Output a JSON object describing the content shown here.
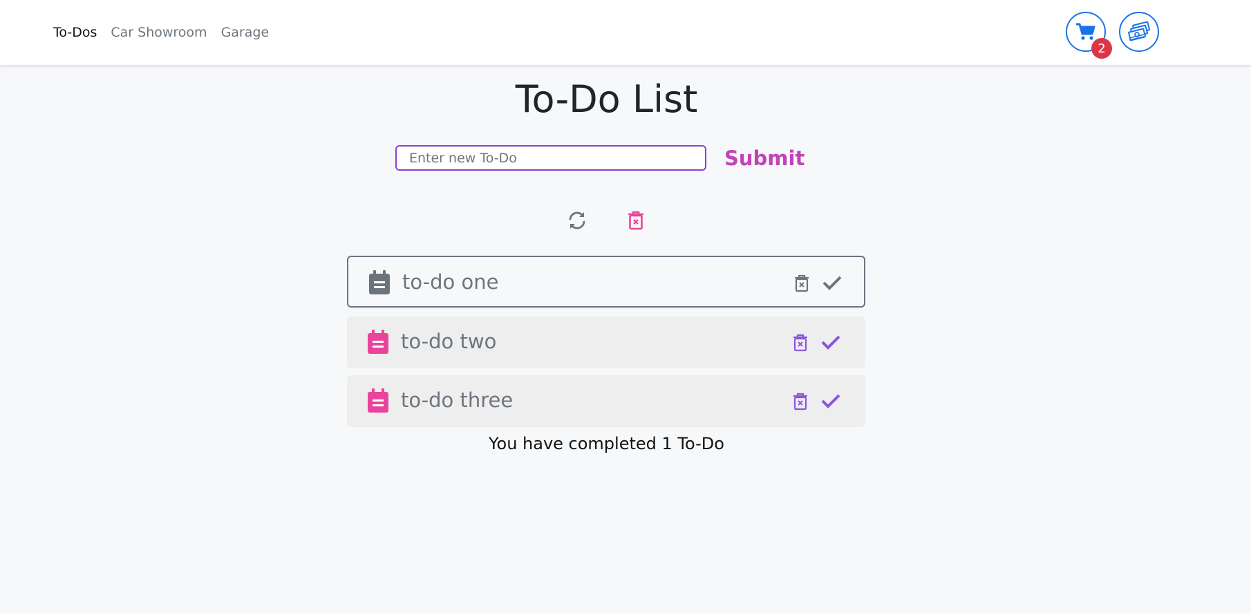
{
  "nav": {
    "links": [
      "To-Dos",
      "Car Showroom",
      "Garage"
    ],
    "cart_badge": "2",
    "cart_icon": "shopping-cart-icon",
    "money_icon": "money-stack-icon",
    "accent": "#1a73e8",
    "badge_color": "#dc3545"
  },
  "main": {
    "title": "To-Do List",
    "input_placeholder": "Enter new To-Do",
    "input_value": "",
    "submit_label": "Submit",
    "refresh_icon": "refresh-icon",
    "clear_icon": "trash-icon"
  },
  "todos": [
    {
      "text": "to-do one",
      "state": "completed",
      "icon": "clipboard-icon",
      "color": "#6c737d"
    },
    {
      "text": "to-do two",
      "state": "open",
      "icon": "clipboard-icon",
      "color": "#e9449c"
    },
    {
      "text": "to-do three",
      "state": "open",
      "icon": "clipboard-icon",
      "color": "#e9449c"
    }
  ],
  "footer": {
    "completed_text": "You have completed 1 To-Do"
  },
  "colors": {
    "input_border": "#8a3fd1",
    "submit": "#c342b8",
    "action_purple": "#8a55e0",
    "pink": "#e9449c",
    "gray": "#6c737d"
  }
}
